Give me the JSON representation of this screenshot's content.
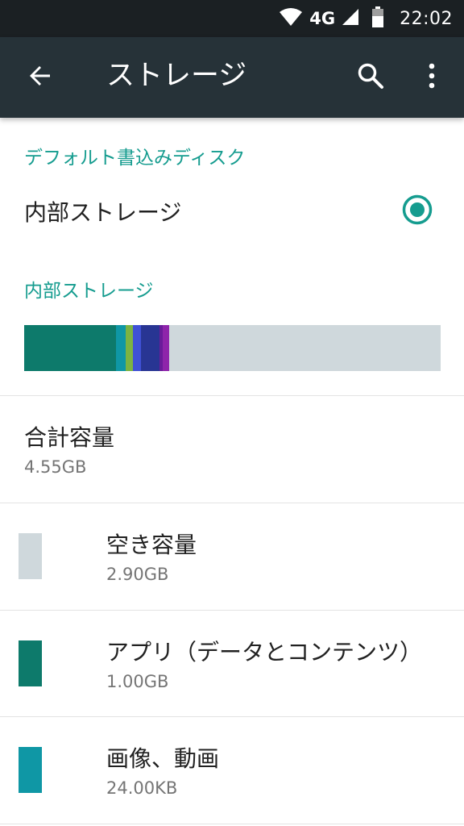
{
  "status_bar": {
    "network": "4G",
    "time": "22:02"
  },
  "app_bar": {
    "title": "ストレージ",
    "icons": [
      "back-arrow-icon",
      "search-icon",
      "more-vert-icon"
    ]
  },
  "default_write_disk": {
    "header": "デフォルト書込みディスク",
    "option_label": "内部ストレージ",
    "selected": true
  },
  "internal_storage": {
    "header": "内部ストレージ",
    "usage_bar": {
      "track_color": "#cfd8dc",
      "segments": [
        {
          "fraction": 0.22,
          "color": "#0d7a6b"
        },
        {
          "fraction": 0.023,
          "color": "#0f97a5"
        },
        {
          "fraction": 0.019,
          "color": "#7cb342"
        },
        {
          "fraction": 0.019,
          "color": "#3f51d5"
        },
        {
          "fraction": 0.044,
          "color": "#283593"
        },
        {
          "fraction": 0.008,
          "color": "#6a1b9a"
        },
        {
          "fraction": 0.016,
          "color": "#8e24aa"
        }
      ]
    },
    "total": {
      "label": "合計容量",
      "value": "4.55GB"
    },
    "items": [
      {
        "label": "空き容量",
        "value": "2.90GB",
        "color": "#cfd8dc"
      },
      {
        "label": "アプリ（データとコンテンツ）",
        "value": "1.00GB",
        "color": "#0d7a6b"
      },
      {
        "label": "画像、動画",
        "value": "24.00KB",
        "color": "#0f97a5"
      }
    ]
  }
}
